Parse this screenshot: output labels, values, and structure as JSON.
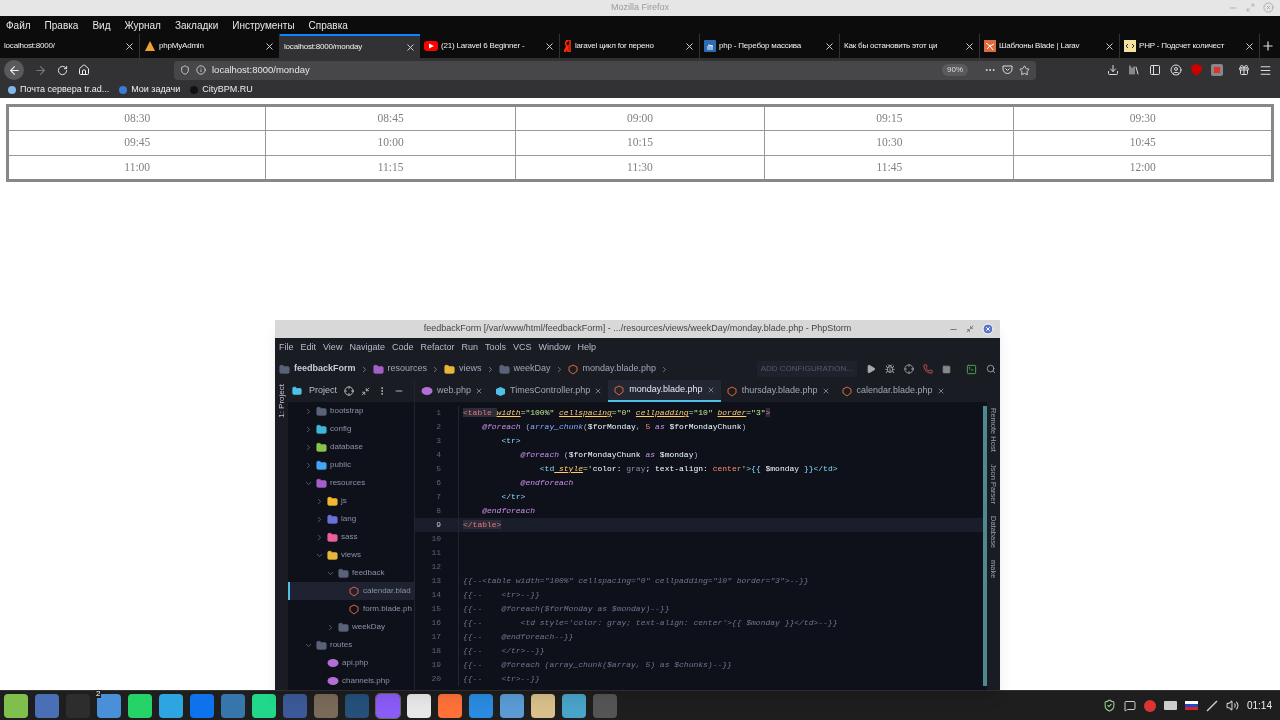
{
  "browser": {
    "title": "Mozilla Firefox",
    "menu": [
      "Файл",
      "Правка",
      "Вид",
      "Журнал",
      "Закладки",
      "Инструменты",
      "Справка"
    ],
    "tabs": [
      {
        "label": "localhost:8000/",
        "kind": "none",
        "selected": false
      },
      {
        "label": "phpMyAdmin",
        "kind": "pma",
        "selected": false
      },
      {
        "label": "localhost:8000/monday",
        "kind": "none",
        "selected": true
      },
      {
        "label": "(21) Laravel 6 Beginner -",
        "kind": "youtube",
        "selected": false
      },
      {
        "label": "laravel цикл for перено",
        "kind": "yandex",
        "selected": false
      },
      {
        "label": "php - Перебор массива",
        "kind": "so",
        "selected": false
      },
      {
        "label": "Как бы остановить этот ци",
        "kind": "none",
        "selected": false
      },
      {
        "label": "Шаблоны Blade | Larav",
        "kind": "blade",
        "selected": false
      },
      {
        "label": "PHP - Подсчет количест",
        "kind": "php",
        "selected": false
      }
    ],
    "url": "localhost:8000/monday",
    "zoom": "90%",
    "bookmarks": [
      "Почта сервера tr.ad...",
      "Мои задачи",
      "CityBPM.RU"
    ]
  },
  "page": {
    "table": {
      "rows": [
        [
          "08:30",
          "08:45",
          "09:00",
          "09:15",
          "09:30"
        ],
        [
          "09:45",
          "10:00",
          "10:15",
          "10:30",
          "10:45"
        ],
        [
          "11:00",
          "11:15",
          "11:30",
          "11:45",
          "12:00"
        ]
      ]
    }
  },
  "ide": {
    "title": "feedbackForm [/var/www/html/feedbackForm] - .../resources/views/weekDay/monday.blade.php - PhpStorm",
    "menu": [
      "File",
      "Edit",
      "View",
      "Navigate",
      "Code",
      "Refactor",
      "Run",
      "Tools",
      "VCS",
      "Window",
      "Help"
    ],
    "breadcrumbs": [
      {
        "label": "feedbackForm",
        "kind": "project"
      },
      {
        "label": "resources",
        "kind": "folder",
        "color": "#a55fc8"
      },
      {
        "label": "views",
        "kind": "folder",
        "color": "#e8b73a"
      },
      {
        "label": "weekDay",
        "kind": "folder",
        "color": "#5a6278"
      },
      {
        "label": "monday.blade.php",
        "kind": "blade"
      }
    ],
    "run_config": "ADD CONFIGURATION...",
    "side_tab": "1: Project",
    "project_label": "Project",
    "tabs": [
      {
        "label": "web.php",
        "kind": "php",
        "selected": false
      },
      {
        "label": "TimesController.php",
        "kind": "class",
        "selected": false
      },
      {
        "label": "monday.blade.php",
        "kind": "blade",
        "selected": true
      },
      {
        "label": "thursday.blade.php",
        "kind": "blade",
        "selected": false
      },
      {
        "label": "calendar.blade.php",
        "kind": "blade",
        "selected": false
      }
    ],
    "tree": [
      {
        "label": "bootstrap",
        "kind": "folder",
        "color": "#5a6278",
        "expanded": false,
        "selected": false
      },
      {
        "label": "config",
        "kind": "folder",
        "color": "#3fb6d6",
        "expanded": false,
        "selected": false
      },
      {
        "label": "database",
        "kind": "folder",
        "color": "#8bc34a",
        "expanded": false,
        "selected": false
      },
      {
        "label": "public",
        "kind": "folder",
        "color": "#42a5f5",
        "expanded": false,
        "selected": false
      },
      {
        "label": "resources",
        "kind": "folder",
        "color": "#a55fc8",
        "expanded": true,
        "selected": false,
        "children": [
          {
            "label": "js",
            "kind": "folder",
            "color": "#f2b632",
            "expanded": false,
            "selected": false
          },
          {
            "label": "lang",
            "kind": "folder",
            "color": "#6a72d9",
            "expanded": false,
            "selected": false
          },
          {
            "label": "sass",
            "kind": "folder",
            "color": "#ec5f9a",
            "expanded": false,
            "selected": false
          },
          {
            "label": "views",
            "kind": "folder",
            "color": "#e8b73a",
            "expanded": true,
            "selected": false,
            "children": [
              {
                "label": "feedback",
                "kind": "folder",
                "color": "#5a6278",
                "expanded": true,
                "selected": false,
                "children": [
                  {
                    "label": "calendar.blad",
                    "kind": "blade",
                    "selected": true
                  },
                  {
                    "label": "form.blade.ph",
                    "kind": "blade",
                    "selected": false
                  }
                ]
              },
              {
                "label": "weekDay",
                "kind": "folder",
                "color": "#5a6278",
                "expanded": false,
                "selected": false
              }
            ]
          }
        ]
      },
      {
        "label": "routes",
        "kind": "folder",
        "color": "#5a6278",
        "expanded": true,
        "selected": false,
        "children": [
          {
            "label": "api.php",
            "kind": "php",
            "selected": false
          },
          {
            "label": "channels.php",
            "kind": "php",
            "selected": false
          }
        ]
      }
    ],
    "lines": [
      {
        "num": "1",
        "current": false,
        "tokens": [
          {
            "t": "<table ",
            "kind": "tag"
          },
          {
            "t": "width",
            "kind": "attr"
          },
          {
            "t": "=\"100%\" ",
            "kind": "str"
          },
          {
            "t": "cellspacing",
            "kind": "attr"
          },
          {
            "t": "=\"0\" ",
            "kind": "str"
          },
          {
            "t": "cellpadding",
            "kind": "attr"
          },
          {
            "t": "=\"10\" ",
            "kind": "str"
          },
          {
            "t": "border",
            "kind": "attr"
          },
          {
            "t": "=\"3\"",
            "kind": "str"
          },
          {
            "t": ">",
            "kind": "tag"
          }
        ]
      },
      {
        "num": "2",
        "current": false,
        "tokens": [
          {
            "t": "    @foreach",
            "kind": "dir"
          },
          {
            "t": " (",
            "kind": "plain"
          },
          {
            "t": "array_chunk",
            "kind": "fn"
          },
          {
            "t": "(",
            "kind": "plain"
          },
          {
            "t": "$forMonday",
            "kind": "var"
          },
          {
            "t": ", ",
            "kind": "plain"
          },
          {
            "t": "5 ",
            "kind": "num"
          },
          {
            "t": "as",
            "kind": "dir"
          },
          {
            "t": " $forMondayChunk",
            "kind": "var"
          },
          {
            "t": ")",
            "kind": "plain"
          }
        ]
      },
      {
        "num": "3",
        "current": false,
        "tokens": [
          {
            "t": "        <tr>",
            "kind": "tag2"
          }
        ]
      },
      {
        "num": "4",
        "current": false,
        "tokens": [
          {
            "t": "            @foreach",
            "kind": "dir"
          },
          {
            "t": " (",
            "kind": "plain"
          },
          {
            "t": "$forMondayChunk",
            "kind": "var"
          },
          {
            "t": " as",
            "kind": "dir"
          },
          {
            "t": " $monday",
            "kind": "var"
          },
          {
            "t": ")",
            "kind": "plain"
          }
        ]
      },
      {
        "num": "5",
        "current": false,
        "tokens": [
          {
            "t": "                <td",
            "kind": "tag2"
          },
          {
            "t": " style",
            "kind": "attr"
          },
          {
            "t": "='",
            "kind": "str"
          },
          {
            "t": "color: ",
            "kind": "var"
          },
          {
            "t": "gray",
            "kind": "muted"
          },
          {
            "t": "; text-align: ",
            "kind": "var"
          },
          {
            "t": "center",
            "kind": "num"
          },
          {
            "t": "'",
            "kind": "str"
          },
          {
            "t": ">{{ ",
            "kind": "tag2"
          },
          {
            "t": "$monday",
            "kind": "var"
          },
          {
            "t": " }}</td>",
            "kind": "tag2"
          }
        ]
      },
      {
        "num": "6",
        "current": false,
        "tokens": [
          {
            "t": "            @endforeach",
            "kind": "dir"
          }
        ]
      },
      {
        "num": "7",
        "current": false,
        "tokens": [
          {
            "t": "        </tr>",
            "kind": "tag2"
          }
        ]
      },
      {
        "num": "8",
        "current": false,
        "tokens": [
          {
            "t": "    @endforeach",
            "kind": "dir"
          }
        ]
      },
      {
        "num": "9",
        "current": true,
        "tokens": [
          {
            "t": "</table>",
            "kind": "tag"
          }
        ]
      },
      {
        "num": "10",
        "current": false
      },
      {
        "num": "11",
        "current": false
      },
      {
        "num": "12",
        "current": false
      },
      {
        "num": "13",
        "current": false,
        "tokens": [
          {
            "t": "{{--<table width=\"100%\" cellspacing=\"0\" cellpadding=\"10\" border=\"3\">--}}",
            "kind": "comment"
          }
        ]
      },
      {
        "num": "14",
        "current": false,
        "tokens": [
          {
            "t": "{{--    <tr>--}}",
            "kind": "comment"
          }
        ]
      },
      {
        "num": "15",
        "current": false,
        "tokens": [
          {
            "t": "{{--    @foreach($forMonday as $monday)--}}",
            "kind": "comment"
          }
        ]
      },
      {
        "num": "16",
        "current": false,
        "tokens": [
          {
            "t": "{{--        <td style='color: gray; text-align: center'>{{ $monday }}</td>--}}",
            "kind": "comment"
          }
        ]
      },
      {
        "num": "17",
        "current": false,
        "tokens": [
          {
            "t": "{{--    @endforeach--}}",
            "kind": "comment"
          }
        ]
      },
      {
        "num": "18",
        "current": false,
        "tokens": [
          {
            "t": "{{--    </tr>--}}",
            "kind": "comment"
          }
        ]
      },
      {
        "num": "19",
        "current": false,
        "tokens": [
          {
            "t": "{{--    @foreach (array_chunk($array, 5) as $chunks)--}}",
            "kind": "comment"
          }
        ]
      },
      {
        "num": "20",
        "current": false,
        "tokens": [
          {
            "t": "{{--    <tr>--}}",
            "kind": "comment"
          }
        ]
      }
    ],
    "right_tools": [
      "Remote Host",
      "Json Parser",
      "Database",
      "make"
    ]
  },
  "taskbar": {
    "badge": "2",
    "clock": "01:14"
  }
}
